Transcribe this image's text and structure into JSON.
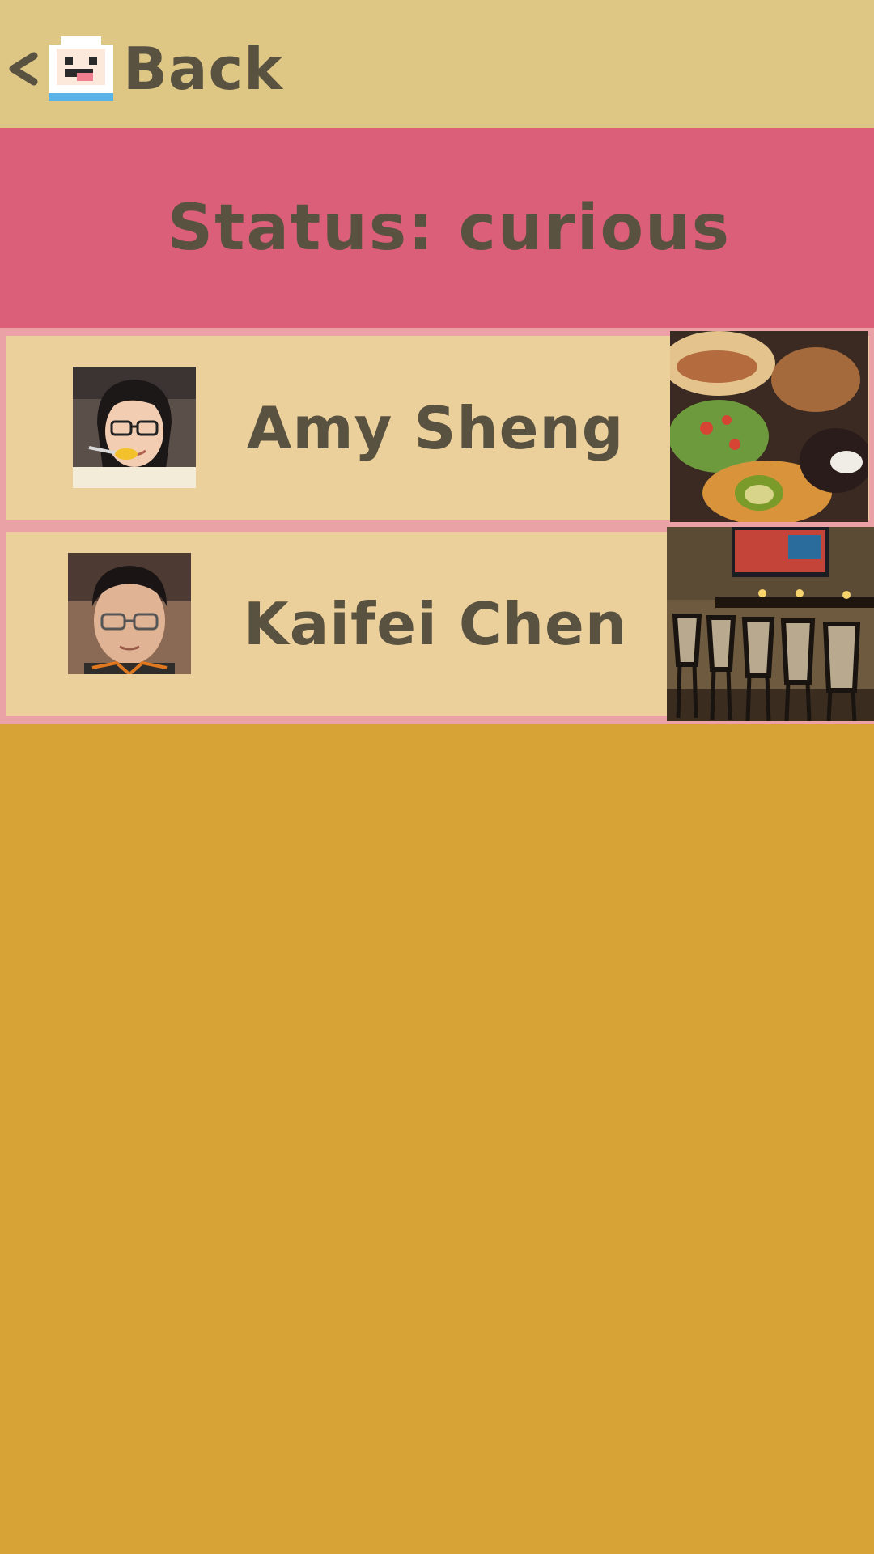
{
  "header": {
    "back_chevron": "<",
    "back_label": "Back",
    "mascot_icon": "mascot-icon"
  },
  "status": {
    "text": "Status: curious"
  },
  "contacts": [
    {
      "name": "Amy Sheng",
      "avatar_icon": "avatar-photo",
      "place_icon": "mexican-food-photo"
    },
    {
      "name": "Kaifei Chen",
      "avatar_icon": "avatar-photo",
      "place_icon": "bar-interior-photo"
    }
  ],
  "colors": {
    "header_bg": "#dec785",
    "status_bg": "#db5f79",
    "list_border": "#eba2a7",
    "row_bg": "#ebd09c",
    "page_bg": "#d7a336",
    "text": "#5a5240"
  }
}
